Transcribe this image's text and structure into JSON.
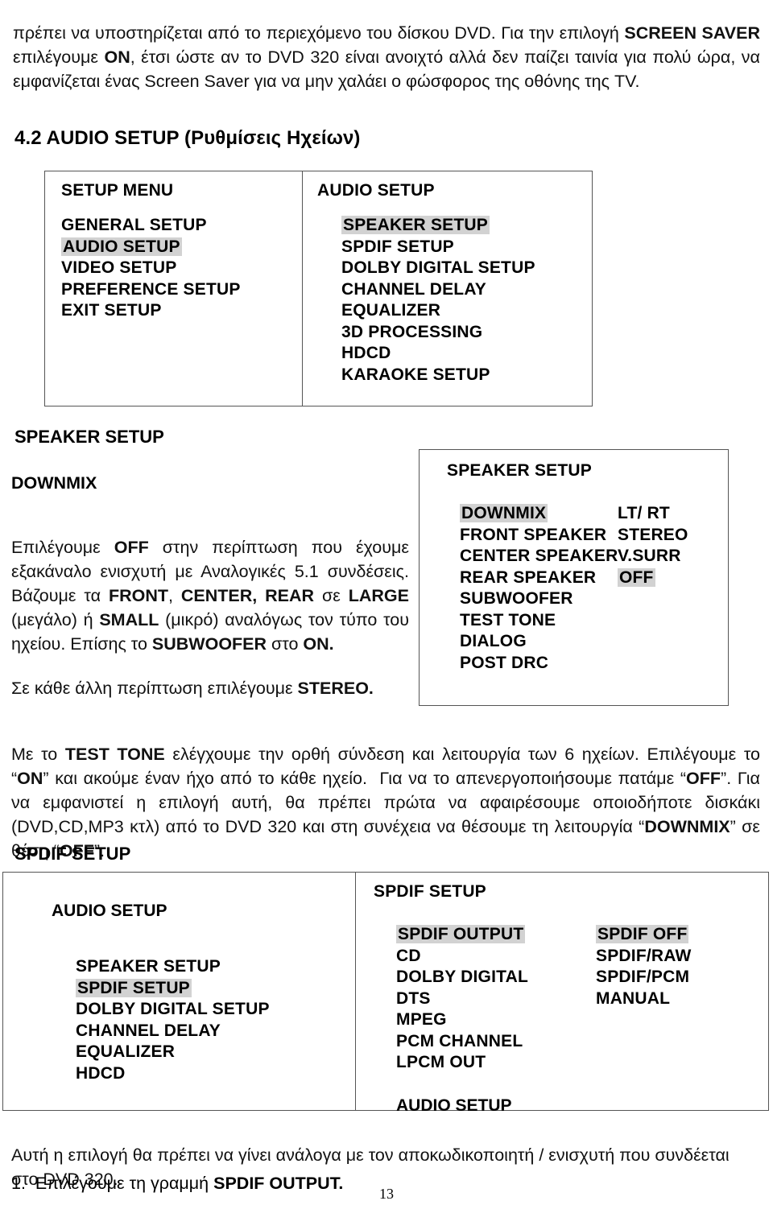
{
  "document": {
    "page_number": "13",
    "intro_paragraph": "πρέπει να υποστηρίζεται από το περιεχόμενο του δίσκου DVD. Για την επιλογή SCREEN SAVER επιλέγουμε ON, έτσι ώστε αν το DVD 320 είναι ανοιχτό αλλά δεν παίζει ταινία για πολύ ώρα, να εμφανίζεται ένας Screen Saver για να μην χαλάει ο φώσφορος της οθόνης της TV.",
    "section_heading": "4.2 AUDIO SETUP (Ρυθμίσεις Ηχείων)"
  },
  "setup_menu_screen": {
    "left": {
      "title": "SETUP MENU",
      "items": [
        {
          "label": "GENERAL SETUP",
          "highlighted": false
        },
        {
          "label": "AUDIO SETUP",
          "highlighted": true
        },
        {
          "label": "VIDEO SETUP",
          "highlighted": false
        },
        {
          "label": "PREFERENCE SETUP",
          "highlighted": false
        },
        {
          "label": "EXIT SETUP",
          "highlighted": false
        }
      ]
    },
    "right": {
      "title": "AUDIO SETUP",
      "items": [
        {
          "label": "SPEAKER SETUP",
          "highlighted": true
        },
        {
          "label": "SPDIF SETUP",
          "highlighted": false
        },
        {
          "label": "DOLBY DIGITAL SETUP",
          "highlighted": false
        },
        {
          "label": "CHANNEL DELAY",
          "highlighted": false
        },
        {
          "label": "EQUALIZER",
          "highlighted": false
        },
        {
          "label": "3D PROCESSING",
          "highlighted": false
        },
        {
          "label": "HDCD",
          "highlighted": false
        },
        {
          "label": "KARAOKE SETUP",
          "highlighted": false
        }
      ]
    }
  },
  "speaker_section": {
    "heading": "SPEAKER SETUP",
    "subheading": "DOWNMIX",
    "paragraph_1": "Επιλέγουμε OFF στην περίπτωση που έχουμε εξακάναλο ενισχυτή με Αναλογικές 5.1 συνδέσεις. Βάζουμε τα FRONT, CENTER, REAR σε LARGE (μεγάλο) ή SMALL (μικρό) αναλόγως τον τύπο του ηχείου. Επίσης το SUBWOOFER στο ON.",
    "paragraph_2": "Σε κάθε άλλη περίπτωση επιλέγουμε STEREO.",
    "osd": {
      "title": "SPEAKER SETUP",
      "rows": [
        {
          "label": "DOWNMIX",
          "label_highlighted": true,
          "value": "LT/ RT",
          "value_highlighted": false
        },
        {
          "label": "FRONT SPEAKER",
          "label_highlighted": false,
          "value": "STEREO",
          "value_highlighted": false
        },
        {
          "label": "CENTER SPEAKER",
          "label_highlighted": false,
          "value": "V.SURR",
          "value_highlighted": false
        },
        {
          "label": "REAR SPEAKER",
          "label_highlighted": false,
          "value": "OFF",
          "value_highlighted": true
        },
        {
          "label": "SUBWOOFER",
          "label_highlighted": false,
          "value": "",
          "value_highlighted": false
        },
        {
          "label": "TEST TONE",
          "label_highlighted": false,
          "value": "",
          "value_highlighted": false
        },
        {
          "label": "DIALOG",
          "label_highlighted": false,
          "value": "",
          "value_highlighted": false
        },
        {
          "label": "POST DRC",
          "label_highlighted": false,
          "value": "",
          "value_highlighted": false
        }
      ]
    }
  },
  "mid_paragraph": "Με το TEST TONE ελέγχουμε την ορθή σύνδεση και λειτουργία των 6 ηχείων. Επιλέγουμε το “ON” και ακούμε έναν ήχο από το κάθε ηχείο.  Για να το απενεργοποιήσουμε πατάμε “OFF”. Για να εμφανιστεί η επιλογή αυτή, θα πρέπει πρώτα να αφαιρέσουμε οποιοδήποτε δισκάκι (DVD,CD,MP3 κτλ) από το DVD 320 και στη συνέχεια να θέσουμε τη λειτουργία “DOWNMIX” σε θέση “OFF”.",
  "spdif_section": {
    "heading": "SPDIF SETUP",
    "left_screen": {
      "title": "AUDIO SETUP",
      "items": [
        {
          "label": "SPEAKER SETUP",
          "highlighted": false
        },
        {
          "label": "SPDIF SETUP",
          "highlighted": true
        },
        {
          "label": "DOLBY DIGITAL SETUP",
          "highlighted": false
        },
        {
          "label": "CHANNEL DELAY",
          "highlighted": false
        },
        {
          "label": "EQUALIZER",
          "highlighted": false
        },
        {
          "label": "HDCD",
          "highlighted": false
        }
      ]
    },
    "right_screen": {
      "title": "SPDIF SETUP",
      "rows": [
        {
          "label": "SPDIF OUTPUT",
          "label_highlighted": true,
          "value": "SPDIF OFF",
          "value_highlighted": true
        },
        {
          "label": "CD",
          "label_highlighted": false,
          "value": "SPDIF/RAW",
          "value_highlighted": false
        },
        {
          "label": "DOLBY DIGITAL",
          "label_highlighted": false,
          "value": "SPDIF/PCM",
          "value_highlighted": false
        },
        {
          "label": "DTS",
          "label_highlighted": false,
          "value": "MANUAL",
          "value_highlighted": false
        },
        {
          "label": "MPEG",
          "label_highlighted": false,
          "value": "",
          "value_highlighted": false
        },
        {
          "label": "PCM CHANNEL",
          "label_highlighted": false,
          "value": "",
          "value_highlighted": false
        },
        {
          "label": "LPCM OUT",
          "label_highlighted": false,
          "value": "",
          "value_highlighted": false
        }
      ],
      "footer": "AUDIO SETUP"
    }
  },
  "bottom": {
    "paragraph": "Αυτή η επιλογή θα πρέπει να γίνει ανάλογα με τον αποκωδικοποιητή / ενισχυτή που συνδέεται στο DVD 320.",
    "list_item_1": "1.  Επιλέγουμε τη γραμμή SPDIF OUTPUT."
  },
  "colors": {
    "highlight": "#d2d2d2",
    "border": "#555555",
    "text": "#000000"
  }
}
